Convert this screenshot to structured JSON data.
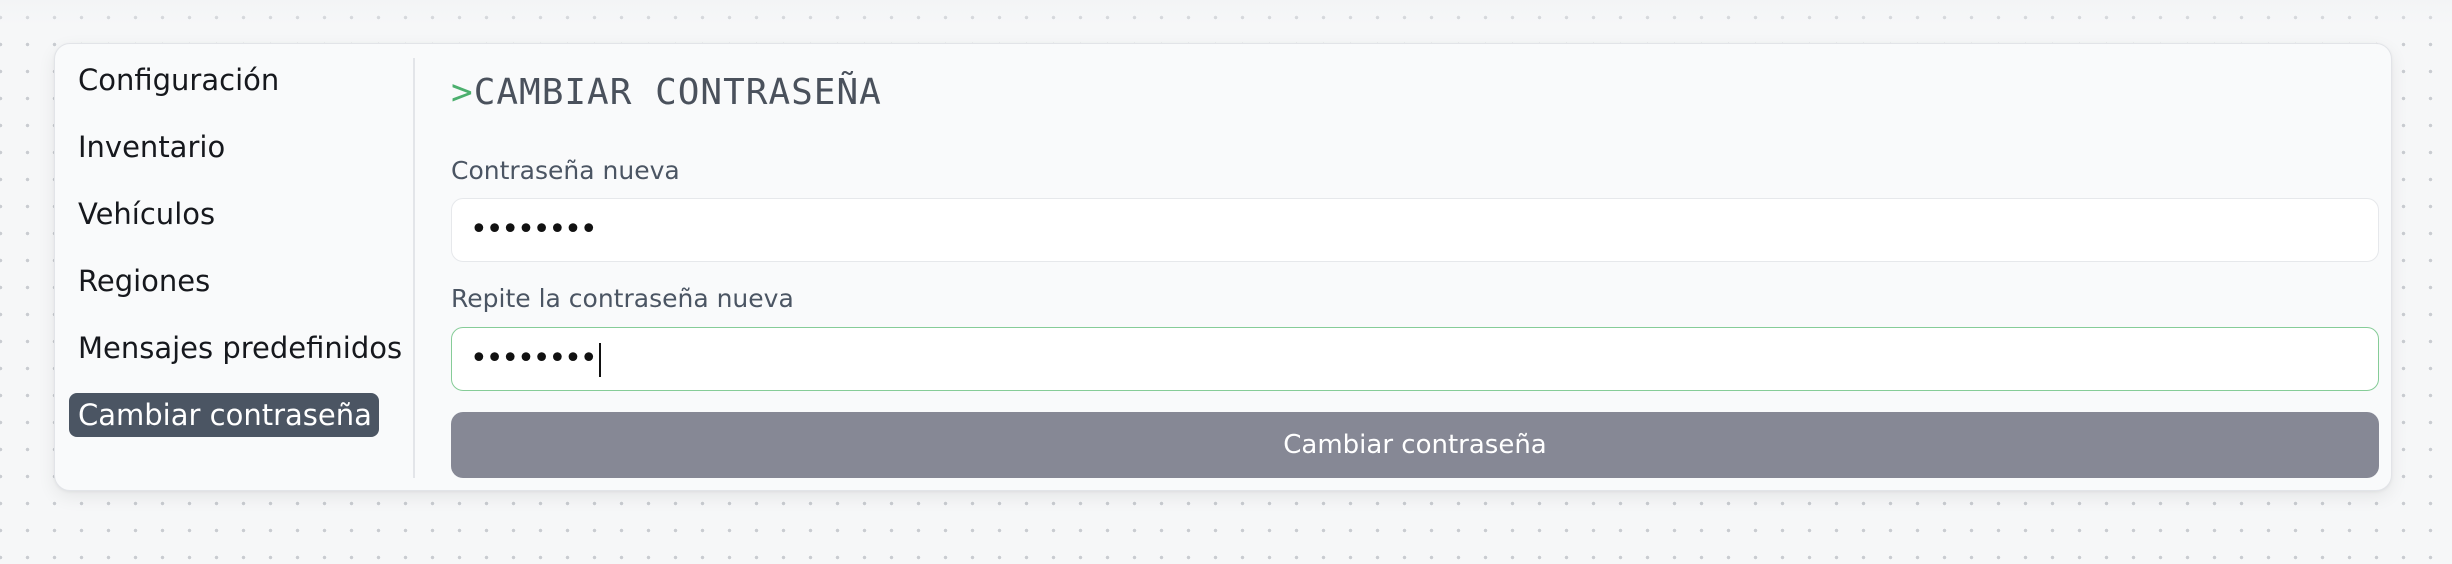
{
  "sidebar": {
    "items": [
      {
        "label": "Configuración"
      },
      {
        "label": "Inventario"
      },
      {
        "label": "Vehículos"
      },
      {
        "label": "Regiones"
      },
      {
        "label": "Mensajes predefinidos"
      },
      {
        "label": "Cambiar contraseña",
        "active": true
      }
    ]
  },
  "main": {
    "title_prefix": ">",
    "title": "CAMBIAR CONTRASEÑA",
    "new_password": {
      "label": "Contraseña nueva",
      "value": "••••••••"
    },
    "repeat_password": {
      "label": "Repite la contraseña nueva",
      "value": "••••••••",
      "focused": true
    },
    "submit_label": "Cambiar contraseña"
  },
  "colors": {
    "active_item_bg": "#4b5563",
    "accent_green": "#4caf6e",
    "focus_border": "#86cc98",
    "button_bg": "#868895"
  }
}
